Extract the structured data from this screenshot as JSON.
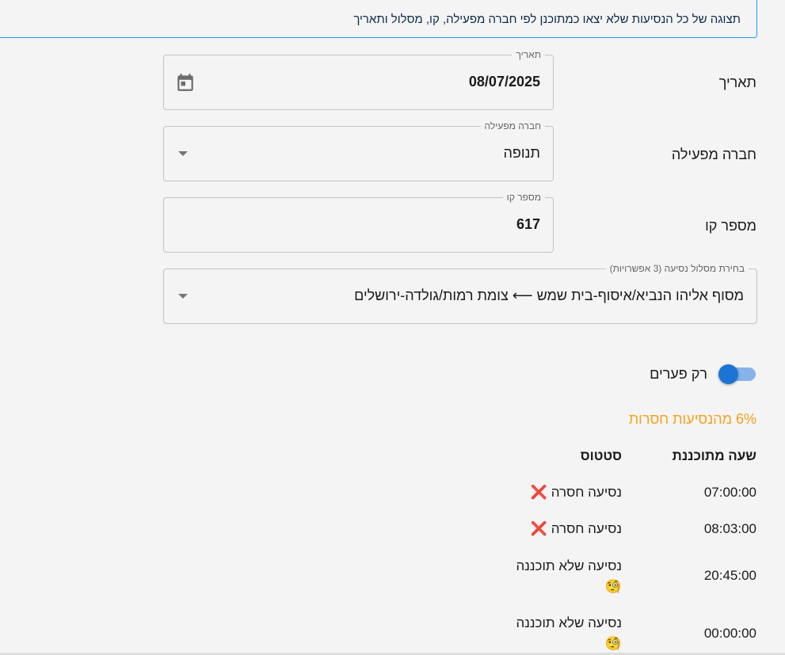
{
  "info_text": "תצוגה של כל הנסיעות שלא יצאו כמתוכנן לפי חברה מפעילה, קו, מסלול ותאריך",
  "form": {
    "date": {
      "label": "תאריך",
      "legend": "תאריך",
      "value": "08/07/2025"
    },
    "operator": {
      "label": "חברה מפעילה",
      "legend": "חברה מפעילה",
      "value": "תנופה"
    },
    "line": {
      "label": "מספר קו",
      "legend": "מספר קו",
      "value": "617"
    },
    "route": {
      "legend": "בחירת מסלול נסיעה (3 אפשרויות)",
      "value": "מסוף אליהו הנביא/איסוף-בית שמש ⟵ צומת רמות/גולדה-ירושלים"
    }
  },
  "toggle": {
    "label": "רק פערים",
    "checked": true
  },
  "missing_percent": "6% מהנסיעות חסרות",
  "colors": {
    "accent": "#1e74d4",
    "warning": "#f5a21b",
    "info_border": "#19a3e8"
  },
  "table": {
    "headers": {
      "time": "שעה מתוכננת",
      "status": "סטטוס"
    },
    "rows": [
      {
        "time": "07:00:00",
        "status": "נסיעה חסרה",
        "icon": "❌"
      },
      {
        "time": "08:03:00",
        "status": "נסיעה חסרה",
        "icon": "❌"
      },
      {
        "time": "20:45:00",
        "status": "נסיעה שלא תוכננה",
        "icon": "🧐"
      },
      {
        "time": "00:00:00",
        "status": "נסיעה שלא תוכננה",
        "icon": "🧐"
      }
    ]
  }
}
